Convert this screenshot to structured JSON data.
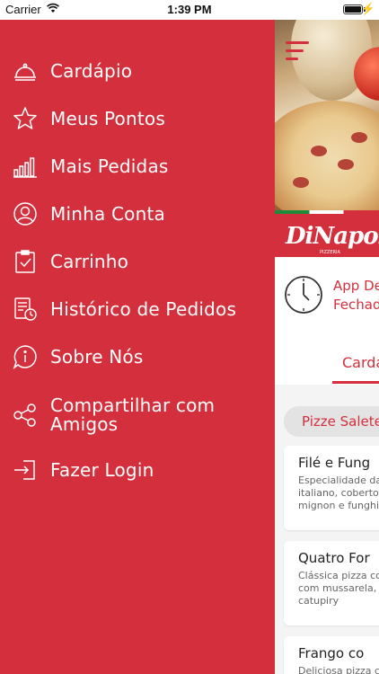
{
  "status_bar": {
    "carrier": "Carrier",
    "time": "1:39 PM"
  },
  "menu": {
    "background_color": "#d42f3c",
    "items": [
      {
        "label": "Cardápio",
        "icon": "cloche-icon"
      },
      {
        "label": "Meus Pontos",
        "icon": "star-icon"
      },
      {
        "label": "Mais Pedidas",
        "icon": "bar-chart-icon"
      },
      {
        "label": "Minha Conta",
        "icon": "user-icon"
      },
      {
        "label": "Carrinho",
        "icon": "clipboard-check-icon"
      },
      {
        "label": "Histórico de Pedidos",
        "icon": "order-history-icon"
      },
      {
        "label": "Sobre Nós",
        "icon": "info-bubble-icon"
      },
      {
        "label": "Compartilhar com Amigos",
        "icon": "share-icon"
      },
      {
        "label": "Fazer Login",
        "icon": "login-icon"
      }
    ]
  },
  "app": {
    "accent_color": "#d42f3c",
    "logo_text": "DiNapoli",
    "logo_subtext": "PIZZERIA",
    "status_line1": "App De",
    "status_line2": "Fechad",
    "active_tab": "Cardá",
    "category": "Pizze Salete",
    "products": [
      {
        "name": "Filé e Fung",
        "desc": "Especialidade da italiano, coberto mignon e funghi"
      },
      {
        "name": "Quatro For",
        "desc": "Clássica pizza co com mussarela, c catupiry"
      },
      {
        "name": "Frango co",
        "desc": "Deliciosa pizza co"
      }
    ]
  }
}
